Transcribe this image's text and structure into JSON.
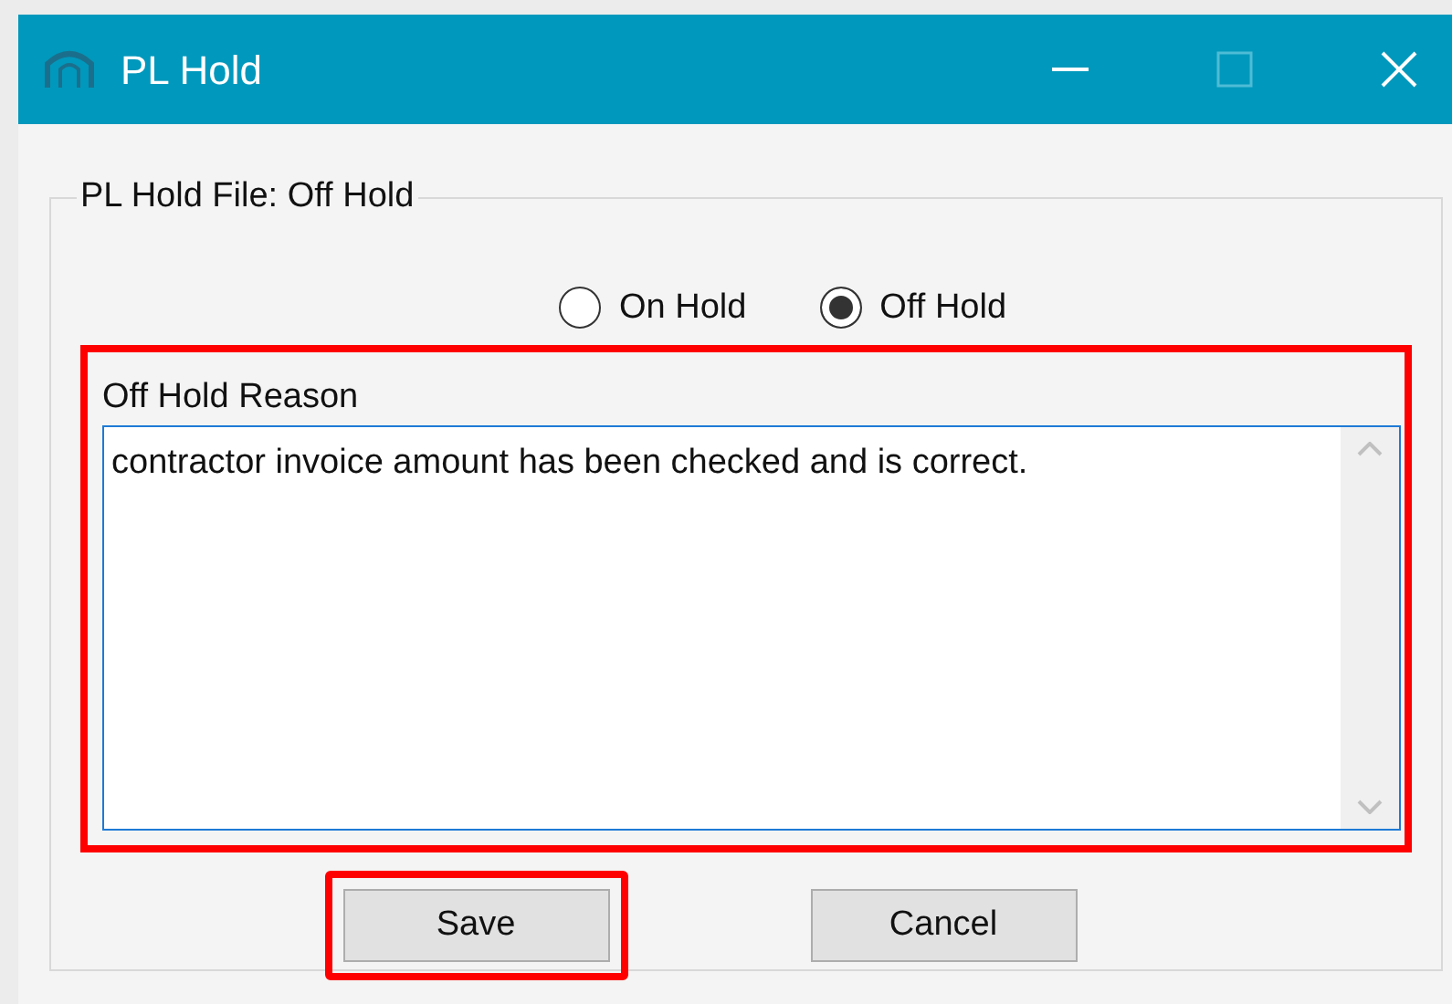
{
  "window": {
    "title": "PL Hold"
  },
  "group": {
    "title": "PL Hold File: Off Hold"
  },
  "radios": [
    {
      "label": "On Hold",
      "selected": false
    },
    {
      "label": "Off Hold",
      "selected": true
    }
  ],
  "reason": {
    "label": "Off Hold Reason",
    "value": "contractor invoice amount has been checked and is correct.",
    "highlighted": true
  },
  "buttons": [
    {
      "label": "Save",
      "highlighted": true
    },
    {
      "label": "Cancel",
      "highlighted": false
    }
  ]
}
